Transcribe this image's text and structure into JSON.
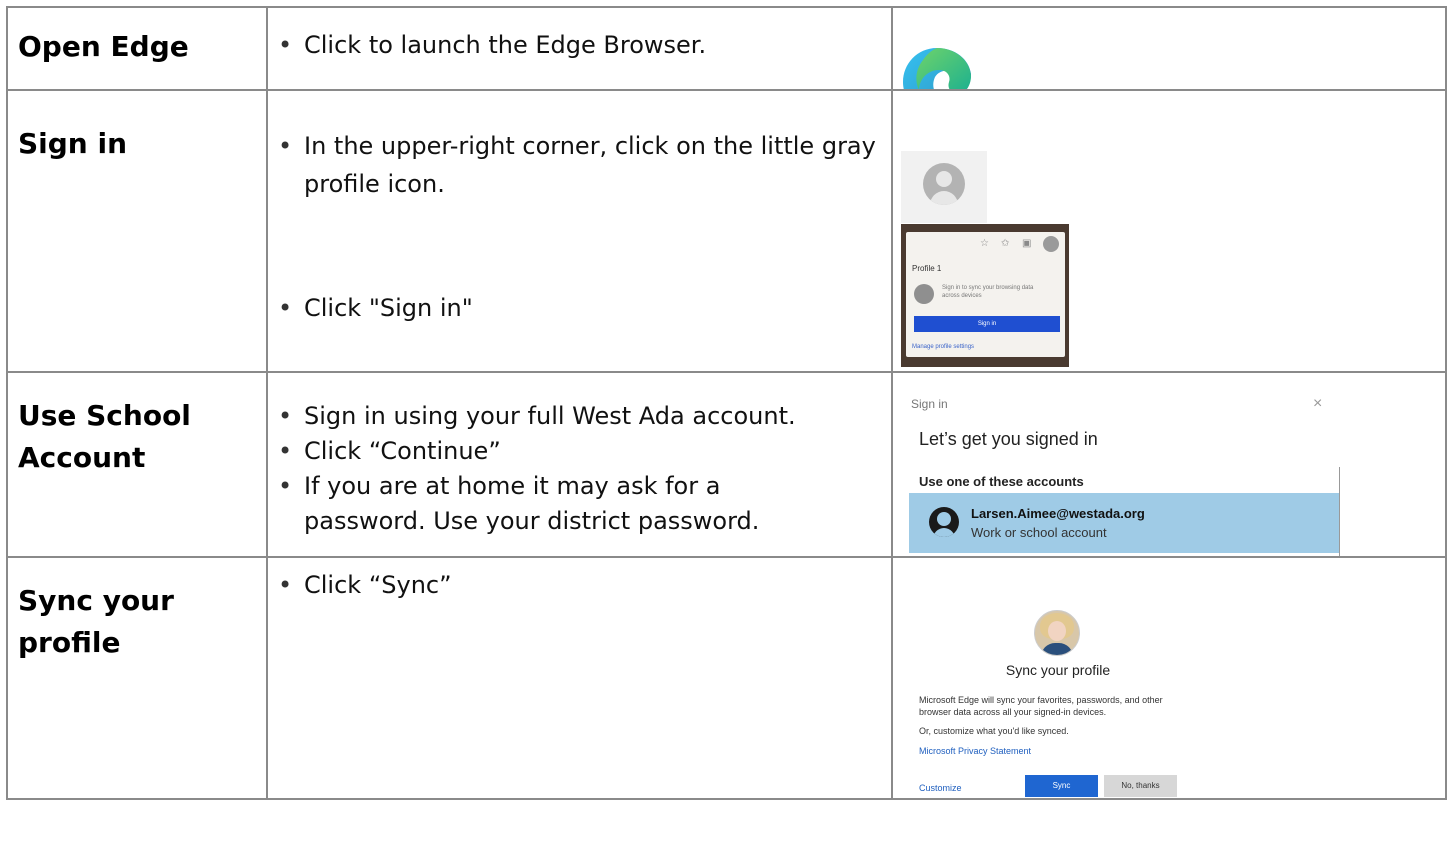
{
  "rows": [
    {
      "title": "Open Edge",
      "bullets": [
        "Click to launch the Edge Browser."
      ]
    },
    {
      "title": "Sign in",
      "bullets": [
        "In the upper-right corner, click on the little gray profile icon.",
        "Click \"Sign in\""
      ]
    },
    {
      "title": "Use School Account",
      "bullets": [
        "Sign in using your full West Ada account.",
        "Click “Continue”",
        "If you are at home it may ask for a password.  Use your district password."
      ]
    },
    {
      "title": "Sync your profile",
      "bullets": [
        "Click “Sync”"
      ]
    }
  ],
  "profile_popup": {
    "label": "Profile 1",
    "text": "Sign in to sync your browsing data across devices",
    "button": "Sign in",
    "link": "Manage profile settings"
  },
  "signin_dialog": {
    "title": "Sign in",
    "close": "×",
    "heading": "Let’s get you signed in",
    "subheading": "Use one of these accounts",
    "account_email": "Larsen.Aimee@westada.org",
    "account_type": "Work or school account"
  },
  "sync_dialog": {
    "heading": "Sync your profile",
    "paragraph": "Microsoft Edge will sync your favorites, passwords, and other browser data across all your signed-in devices.",
    "paragraph2": "Or, customize what you'd like synced.",
    "link": "Microsoft Privacy Statement",
    "customize": "Customize",
    "sync_button": "Sync",
    "no_button": "No, thanks"
  },
  "colors": {
    "border": "#8a8a8a",
    "account_highlight": "#9fcbe6",
    "sync_blue": "#1f66d1"
  }
}
